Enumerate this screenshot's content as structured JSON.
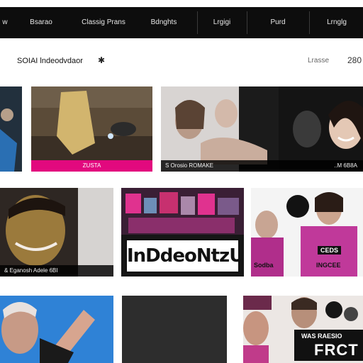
{
  "nav": {
    "items": [
      "w",
      "Bsarao",
      "Classig Prans",
      "Bdnghts",
      "Lrgigi",
      "Purd",
      "Lrnglg"
    ]
  },
  "subbar": {
    "title": "SOIAI lndeodvdaor",
    "star": "✱",
    "sort_label": "Lrasse",
    "count": "280"
  },
  "tiles": {
    "r1c1": {
      "caption": ""
    },
    "r1c2": {
      "caption": "ZUSTA"
    },
    "r1c3": {
      "caption": "S Orosio ROMAKE"
    },
    "r1c4": {
      "caption": "..M 6B8A"
    },
    "r2c1": {
      "caption": "& Eganosh Adele 6BI"
    },
    "r2c2": {
      "banner": "InDdeoNtzU",
      "caption": ""
    },
    "r2c3": {
      "label_a": "CEDS",
      "label_b": "Sodba",
      "label_c": "INGCEE"
    },
    "r3c1": {
      "caption": ""
    },
    "r3c2": {
      "caption": ""
    },
    "r3c3": {
      "sign_small": "WAS RAESIO",
      "sign_big": "FRCT"
    }
  },
  "colors": {
    "nav_bg": "#0d0d0d",
    "accent_pink": "#e2097e",
    "page_bg": "#ffffff"
  }
}
